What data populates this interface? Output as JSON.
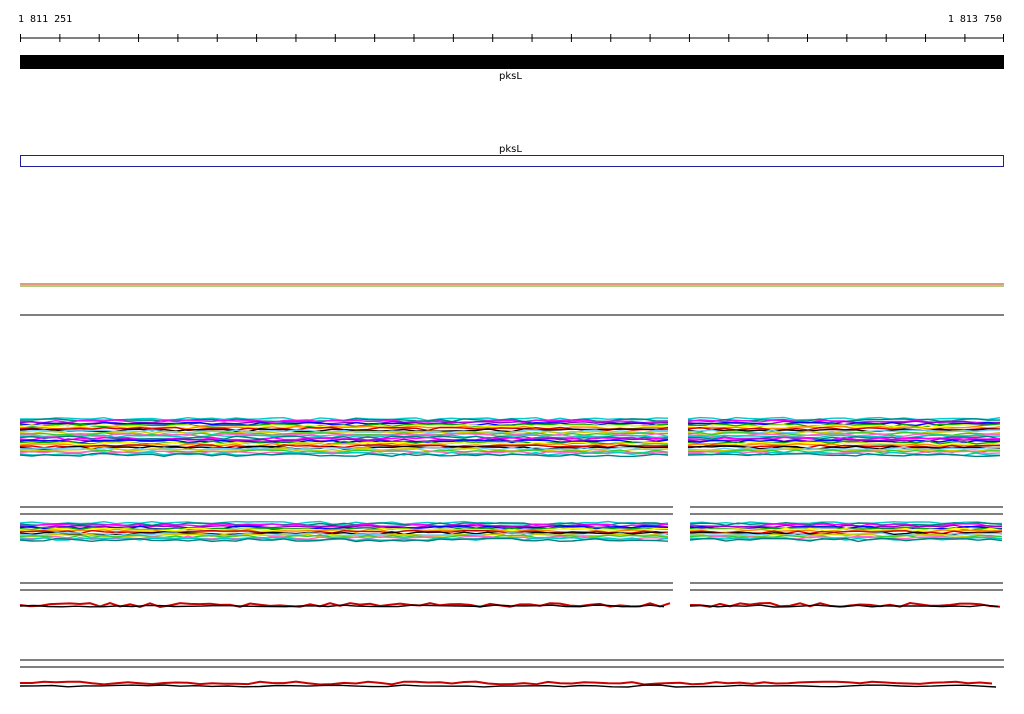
{
  "ruler": {
    "start_coord": "1 811 251",
    "end_coord": "1 813 750"
  },
  "features": [
    {
      "label": "pksL",
      "style": "filled",
      "color": "#000000"
    },
    {
      "label": "pksL",
      "style": "outline",
      "color": "#1f1f9c"
    }
  ],
  "track_colors": [
    "#00cccc",
    "#008080",
    "#ff00ff",
    "#9900cc",
    "#0000ff",
    "#00aa00",
    "#ffff00",
    "#ff8800",
    "#cc0000",
    "#000000",
    "#66ccff",
    "#cccc00",
    "#33cc33",
    "#ff66cc"
  ]
}
